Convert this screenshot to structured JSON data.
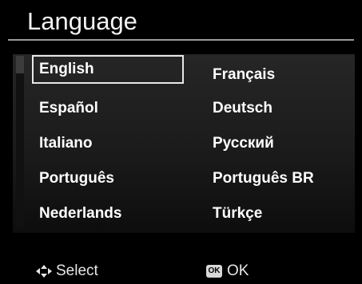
{
  "title": "Language",
  "languages": {
    "col1": [
      "English",
      "Español",
      "Italiano",
      "Português",
      "Nederlands"
    ],
    "col2": [
      "Français",
      "Deutsch",
      "Русский",
      "Português BR",
      "Türkçe"
    ]
  },
  "selected": "English",
  "footer": {
    "select_icon": "four-way-arrow-icon",
    "select_label": "Select",
    "ok_icon": "ok-button-icon",
    "ok_icon_text": "OK",
    "ok_label": "OK"
  },
  "colors": {
    "background": "#000000",
    "text": "#ffffff",
    "selection_border": "#e8e8e8"
  }
}
